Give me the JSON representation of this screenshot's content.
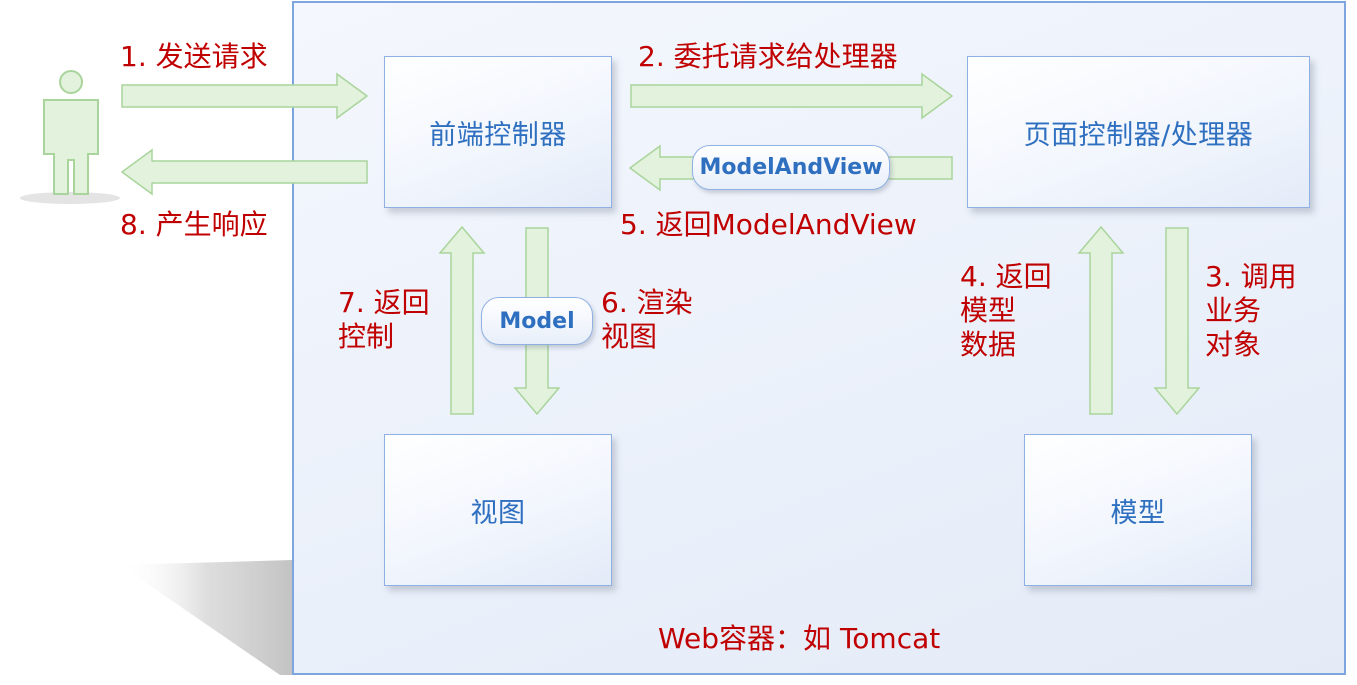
{
  "boxes": {
    "front_controller": "前端控制器",
    "page_controller": "页面控制器/处理器",
    "view": "视图",
    "model": "模型"
  },
  "pills": {
    "model_and_view": "ModelAndView",
    "model": "Model"
  },
  "steps": {
    "step1": "1. 发送请求",
    "step2": "2. 委托请求给处理器",
    "step3": "3. 调用\n业务\n对象",
    "step4": "4. 返回\n模型\n数据",
    "step5": "5. 返回ModelAndView",
    "step6": "6. 渲染\n视图",
    "step7": "7. 返回\n控制",
    "step8": "8. 产生响应"
  },
  "container_label": "Web容器：如 Tomcat",
  "colors": {
    "box_text": "#2e6fc0",
    "step_text": "#c00000",
    "arrow_fill": "#e2f2dc",
    "arrow_stroke": "#a9d49b",
    "border": "#7ea6de"
  },
  "icons": {
    "user": "person-icon"
  }
}
